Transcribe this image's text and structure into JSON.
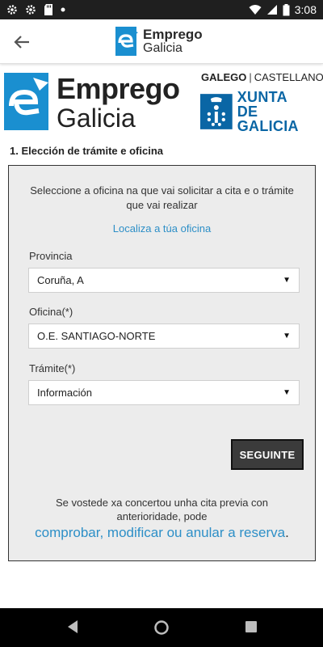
{
  "status_bar": {
    "time": "3:08",
    "left_icons": [
      "settings-icon",
      "gear-icon",
      "sd-card-icon",
      "dot-icon"
    ],
    "right_icons": [
      "wifi-icon",
      "signal-icon",
      "battery-icon"
    ]
  },
  "app_bar": {
    "brand_line1": "Emprego",
    "brand_line2": "Galicia"
  },
  "header": {
    "brand_line1": "Emprego",
    "brand_line2": "Galicia",
    "lang_galego": "GALEGO",
    "lang_separator": "|",
    "lang_castellano": "CASTELLANO",
    "xunta_line1": "XUNTA",
    "xunta_line2": "DE GALICIA"
  },
  "form": {
    "section_title": "1. Elección de trámite e oficina",
    "intro": "Seleccione a oficina na que vai solicitar a cita e o trámite que vai realizar",
    "localiza_link": "Localiza a túa oficina",
    "provincia_label": "Provincia",
    "provincia_value": "Coruña, A",
    "oficina_label": "Oficina(*)",
    "oficina_value": "O.E. SANTIAGO-NORTE",
    "tramite_label": "Trámite(*)",
    "tramite_value": "Información",
    "seguinte_button": "SEGUINTE",
    "previa_text": "Se vostede xa concertou unha cita previa con anterioridade, pode",
    "reserva_link": "comprobar, modificar ou anular a reserva",
    "reserva_dot": "."
  },
  "colors": {
    "link_blue": "#2d8fc7",
    "xunta_blue": "#0a66a5",
    "button_dark": "#3b3b3b",
    "panel_gray": "#ececec"
  }
}
